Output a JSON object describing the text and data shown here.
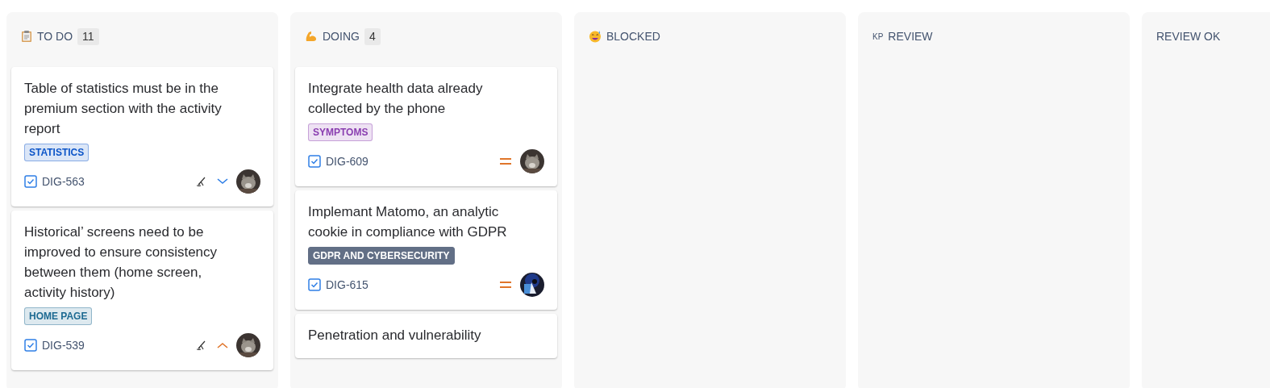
{
  "columns": [
    {
      "kind": "clipboard",
      "title": "TO DO",
      "count": "11",
      "cards": [
        {
          "title": "Table of statistics must be in the premium section with the activity report",
          "tag": {
            "label": "STATISTICS",
            "color": "#0c55c8",
            "kind": "subtle"
          },
          "key": "DIG-563",
          "edited": true,
          "kind": "low"
        },
        {
          "title": "Historical’ screens need to be improved to ensure consistency between them (home screen, activity history)",
          "tag": {
            "label": "HOME PAGE",
            "color": "#1d6a92",
            "kind": "subtle"
          },
          "key": "DIG-539",
          "edited": true,
          "kind": "high"
        }
      ]
    },
    {
      "kind": "arm",
      "title": "DOING",
      "count": "4",
      "cards": [
        {
          "title": "Integrate health data already collected by the phone",
          "tag": {
            "label": "SYMPTOMS",
            "color": "#8a3eb0",
            "kind": "subtle"
          },
          "key": "DIG-609",
          "edited": false,
          "kind": "medium"
        },
        {
          "title": "Implemant Matomo, an analytic cookie in compliance with GDPR",
          "tag": {
            "label": "GDPR AND CYBERSECURITY",
            "color": "#626f86",
            "kind": "bold"
          },
          "key": "DIG-615",
          "edited": false,
          "kind": "medium"
        },
        {
          "title": "Penetration and vulnerability"
        }
      ]
    },
    {
      "kind": "smiley",
      "title": "BLOCKED"
    },
    {
      "kind": "prefix",
      "prefix": "KP",
      "title": "REVIEW"
    },
    {
      "kind": "plain",
      "title": "REVIEW OK"
    }
  ]
}
